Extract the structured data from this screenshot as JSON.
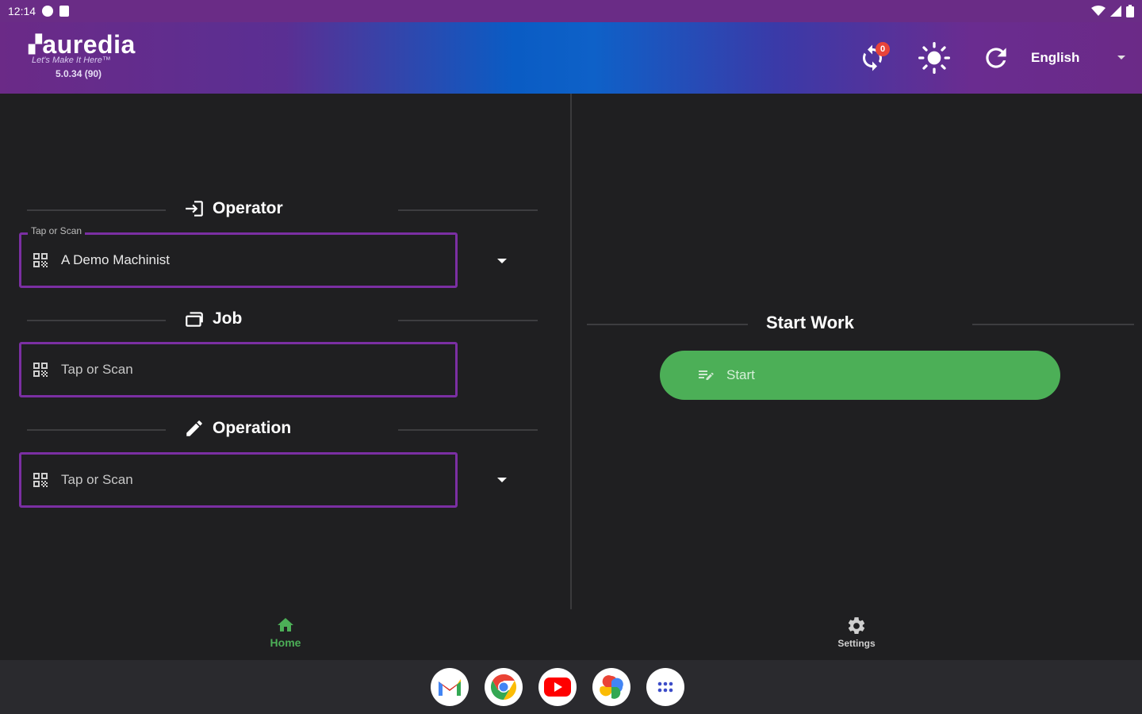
{
  "status_bar": {
    "time": "12:14"
  },
  "app_bar": {
    "logo_word": "auredia",
    "tagline": "Let's Make It Here™",
    "version": "5.0.34 (90)",
    "sync_badge": "0",
    "language": "English"
  },
  "left_panel": {
    "operator": {
      "title": "Operator",
      "float_label": "Tap or Scan",
      "value": "A Demo Machinist"
    },
    "job": {
      "title": "Job",
      "placeholder": "Tap or Scan"
    },
    "operation": {
      "title": "Operation",
      "placeholder": "Tap or Scan"
    }
  },
  "right_panel": {
    "title": "Start Work",
    "start_label": "Start"
  },
  "bottom_nav": {
    "home": "Home",
    "settings": "Settings"
  },
  "colors": {
    "accent_purple": "#7b2fa3",
    "start_green": "#4caf57",
    "badge_red": "#e8443a"
  },
  "dock": {
    "apps": [
      "gmail-icon",
      "chrome-icon",
      "youtube-icon",
      "photos-icon",
      "app-drawer-icon"
    ]
  }
}
